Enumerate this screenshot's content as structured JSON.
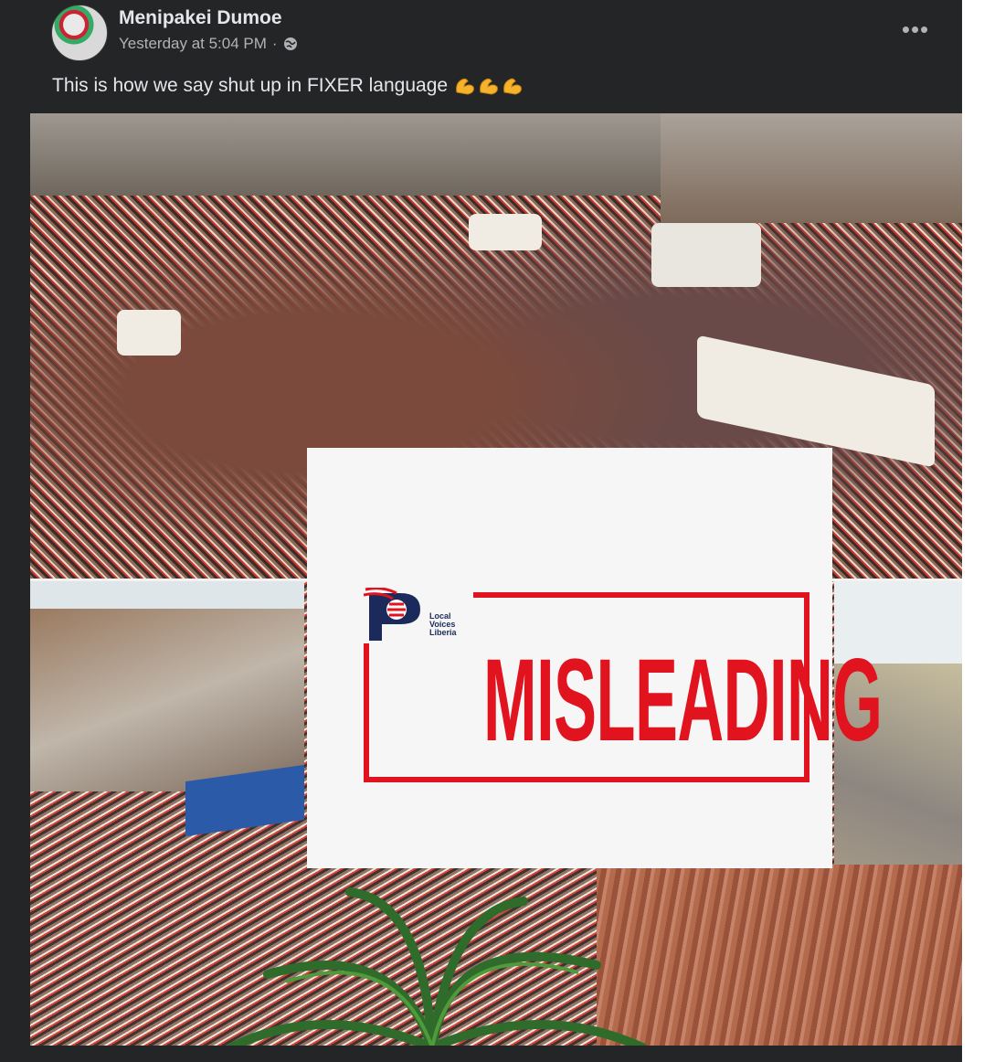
{
  "post": {
    "author": "Menipakei Dumoe",
    "timestamp": "Yesterday at 5:04 PM",
    "separator": "·",
    "privacy_icon": "globe-icon",
    "more_icon": "ellipsis-icon",
    "more_label": "•••",
    "caption": "This is how we say shut up in FIXER language",
    "caption_emoji": "💪💪💪",
    "theme": {
      "background": "#242526",
      "primary_text": "#e4e6eb",
      "secondary_text": "#b0b3b8"
    }
  },
  "image": {
    "stamp_text": "MISLEADING",
    "logo_lines": [
      "Local",
      "Voices",
      "Liberia"
    ],
    "stamp_color": "#e1131e"
  }
}
